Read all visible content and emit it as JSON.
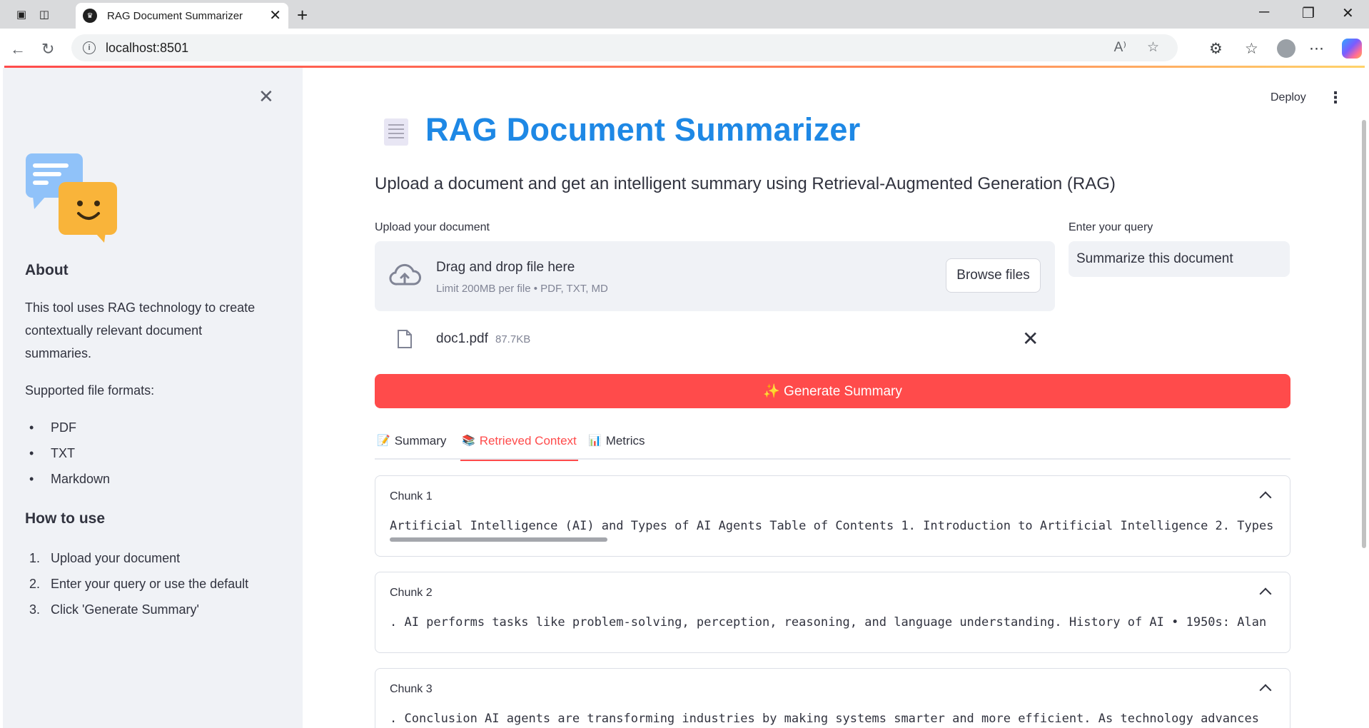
{
  "browser": {
    "tab_title": "RAG Document Summarizer",
    "url": "localhost:8501"
  },
  "sidebar": {
    "about_heading": "About",
    "about_text": "This tool uses RAG technology to create contextually relevant document summaries.",
    "formats_label": "Supported file formats:",
    "formats": [
      "PDF",
      "TXT",
      "Markdown"
    ],
    "howto_heading": "How to use",
    "steps": [
      "Upload your document",
      "Enter your query or use the default",
      "Click 'Generate Summary'"
    ]
  },
  "header": {
    "deploy_label": "Deploy"
  },
  "main": {
    "title": "RAG Document Summarizer",
    "subtitle": "Upload a document and get an intelligent summary using Retrieval-Augmented Generation (RAG)",
    "upload_label": "Upload your document",
    "dropzone_title": "Drag and drop file here",
    "dropzone_limit": "Limit 200MB per file • PDF, TXT, MD",
    "browse_label": "Browse files",
    "query_label": "Enter your query",
    "query_value": "Summarize this document",
    "file_name": "doc1.pdf",
    "file_size": "87.7KB",
    "generate_label": "✨ Generate Summary",
    "tabs": [
      {
        "icon": "📝",
        "label": "Summary",
        "active": false
      },
      {
        "icon": "📚",
        "label": "Retrieved Context",
        "active": true
      },
      {
        "icon": "📊",
        "label": "Metrics",
        "active": false
      }
    ],
    "chunks": [
      {
        "title": "Chunk 1",
        "text": "Artificial Intelligence (AI) and Types of AI Agents Table of Contents 1. Introduction to Artificial Intelligence 2. Types"
      },
      {
        "title": "Chunk 2",
        "text": ". AI performs tasks like problem-solving, perception, reasoning, and language understanding. History of AI • 1950s: Alan"
      },
      {
        "title": "Chunk 3",
        "text": ". Conclusion AI agents are transforming industries by making systems smarter and more efficient. As technology advances"
      }
    ]
  },
  "colors": {
    "accent": "#ff4b4b",
    "title_blue": "#1e88e5",
    "sidebar_bg": "#f0f2f6"
  }
}
